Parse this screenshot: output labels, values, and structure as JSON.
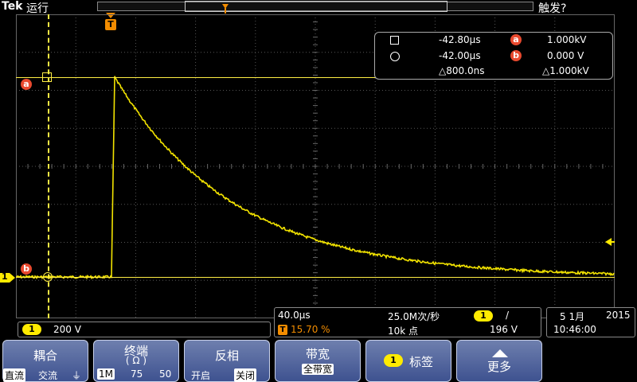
{
  "header": {
    "brand": "Tek",
    "run_status": "运行",
    "trigger_status": "触发?",
    "trigger_marker": "T"
  },
  "markers": {
    "cursor_a": "a",
    "cursor_b": "b",
    "channel": "1",
    "trigger_time": "T"
  },
  "cursors": {
    "row1_time": "-42.80µs",
    "row1_badge": "a",
    "row1_value": "1.000kV",
    "row2_time": "-42.00µs",
    "row2_badge": "b",
    "row2_value": "0.000 V",
    "delta_time": "△800.0ns",
    "delta_value": "△1.000kV"
  },
  "channel_panel": {
    "channel": "1",
    "scale": "200 V"
  },
  "acq_panel": {
    "timebase": "40.0µs",
    "sample_rate": "25.0M次/秒",
    "trigger_channel": "1",
    "trigger_slope": "/",
    "trigger_pos_label": "T",
    "trigger_pos": "15.70 %",
    "record_length": "10k 点",
    "trigger_level": "196 V"
  },
  "date_panel": {
    "date": "5 1月",
    "year": "2015",
    "time": "10:46:00"
  },
  "softkeys": {
    "coupling": {
      "title": "耦合",
      "opt_dc": "直流",
      "opt_ac": "交流",
      "opt_gnd": "⏚"
    },
    "termination": {
      "title": "终端",
      "unit": "( Ω )",
      "opt_1m": "1M",
      "opt_75": "75",
      "opt_50": "50"
    },
    "invert": {
      "title": "反相",
      "opt_on": "开启",
      "opt_off": "关闭"
    },
    "bandwidth": {
      "title": "带宽",
      "value": "全带宽"
    },
    "label": {
      "channel": "1",
      "title": "标签"
    },
    "more": {
      "title": "更多"
    }
  },
  "colors": {
    "trace": "#f2e300",
    "cursor_line": "#ffee44",
    "accent_red": "#e8492e",
    "softkey": "#4a5d9a"
  }
}
